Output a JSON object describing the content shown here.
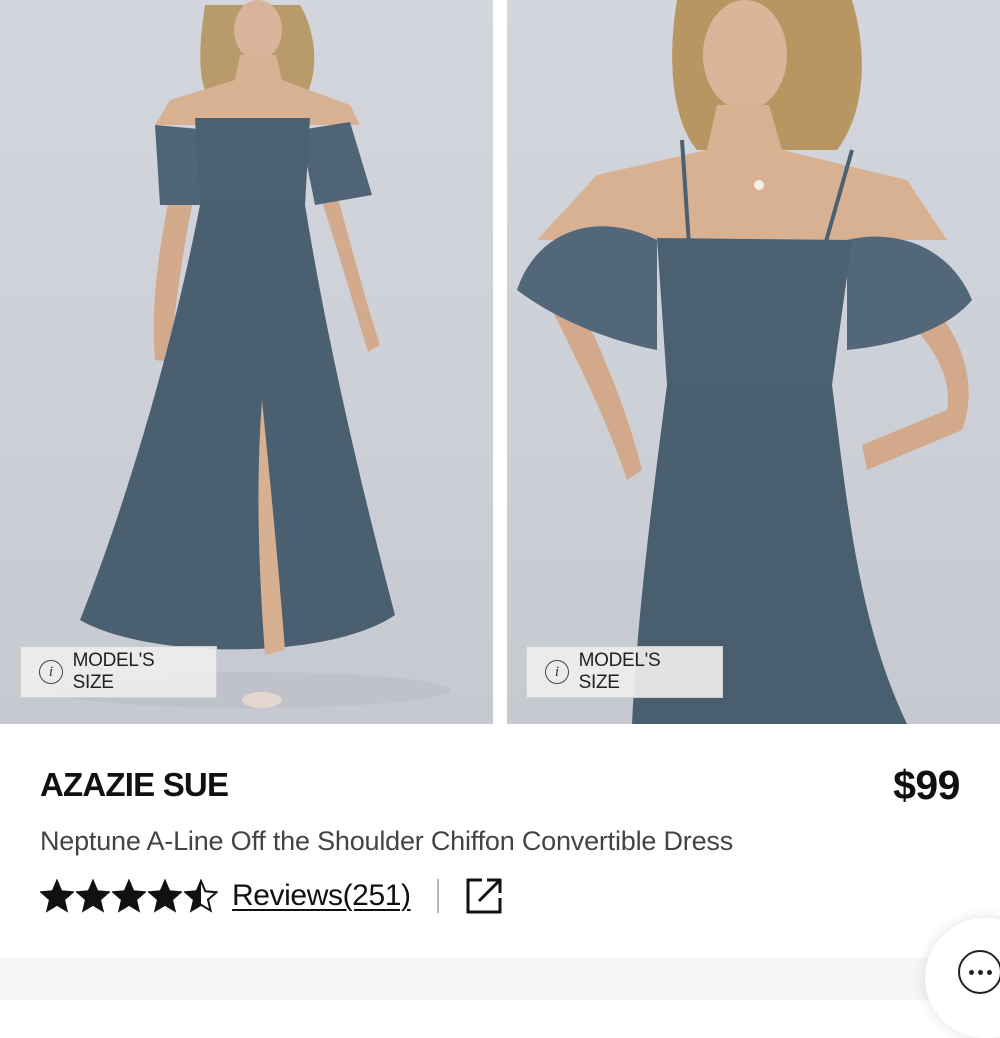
{
  "gallery": {
    "images": [
      {
        "alt_label": "MODEL'S SIZE"
      },
      {
        "alt_label": "MODEL'S SIZE"
      }
    ],
    "dress_color": "#4b6172"
  },
  "product": {
    "brand": "AZAZIE SUE",
    "price": "$99",
    "name": "Neptune A-Line Off the Shoulder Chiffon Convertible Dress",
    "rating": 4.5,
    "rating_max": 5,
    "reviews_label": "Reviews(251)"
  },
  "icons": {
    "info": "info-icon",
    "star": "star-icon",
    "share": "external-link-icon",
    "chat": "chat-icon"
  },
  "info_glyph": "i"
}
